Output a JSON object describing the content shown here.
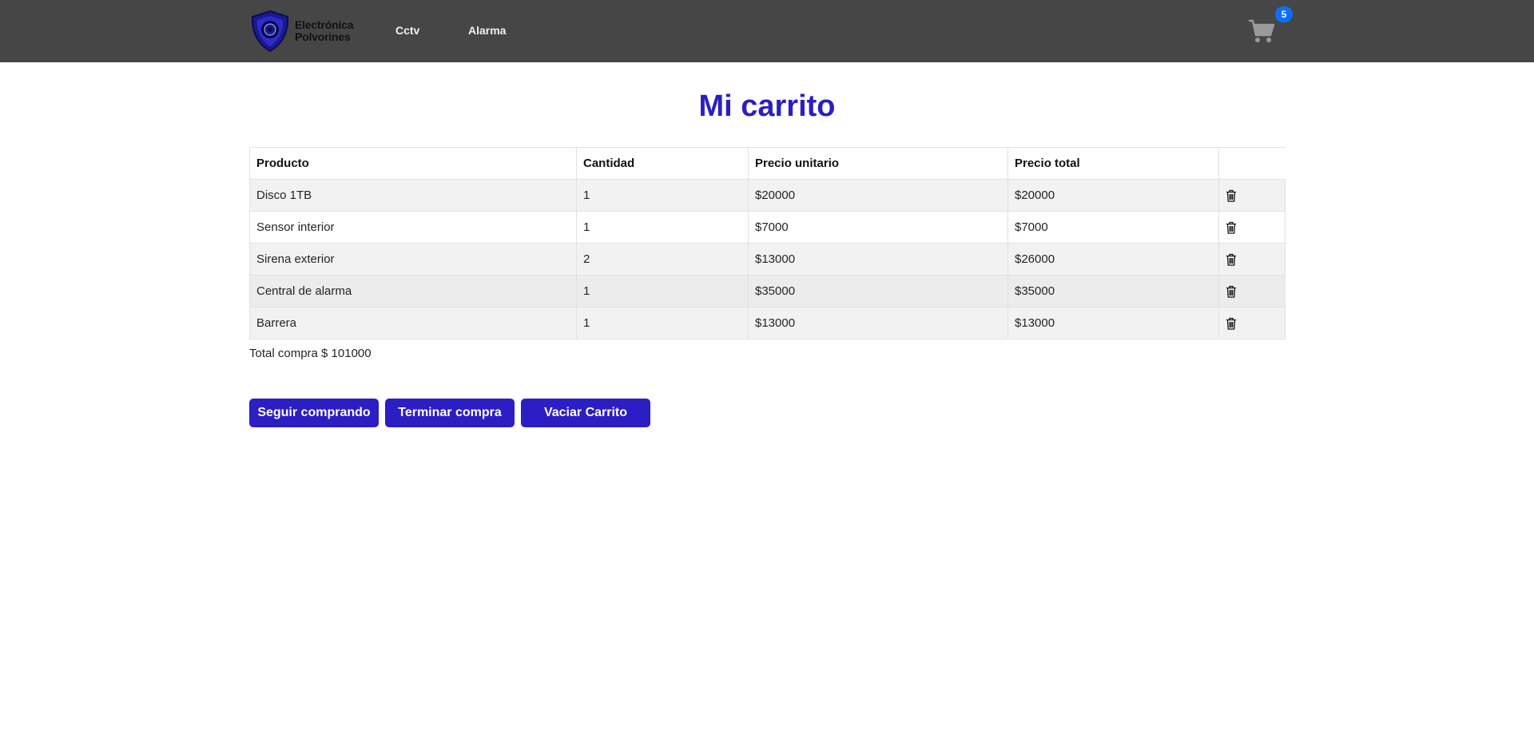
{
  "navbar": {
    "brand": {
      "line1": "Electrónica",
      "line2": "Polvorines"
    },
    "links": [
      {
        "label": "Cctv"
      },
      {
        "label": "Alarma"
      }
    ],
    "cart_count": "5"
  },
  "page_title": "Mi carrito",
  "table": {
    "headers": {
      "product": "Producto",
      "quantity": "Cantidad",
      "unit_price": "Precio unitario",
      "total_price": "Precio total",
      "actions": ""
    },
    "rows": [
      {
        "product": "Disco 1TB",
        "quantity": "1",
        "unit_price": "$20000",
        "total_price": "$20000"
      },
      {
        "product": "Sensor interior",
        "quantity": "1",
        "unit_price": "$7000",
        "total_price": "$7000"
      },
      {
        "product": "Sirena exterior",
        "quantity": "2",
        "unit_price": "$13000",
        "total_price": "$26000"
      },
      {
        "product": "Central de alarma",
        "quantity": "1",
        "unit_price": "$35000",
        "total_price": "$35000"
      },
      {
        "product": "Barrera",
        "quantity": "1",
        "unit_price": "$13000",
        "total_price": "$13000"
      }
    ],
    "delete_icon": "trash-icon"
  },
  "summary": {
    "total_label": "Total compra $ 101000"
  },
  "buttons": {
    "continue_label": "Seguir comprando",
    "checkout_label": "Terminar compra",
    "empty_label": "Vaciar Carrito"
  },
  "colors": {
    "navbar_bg": "#464646",
    "accent": "#2b1ec4",
    "badge": "#0d6efd"
  }
}
